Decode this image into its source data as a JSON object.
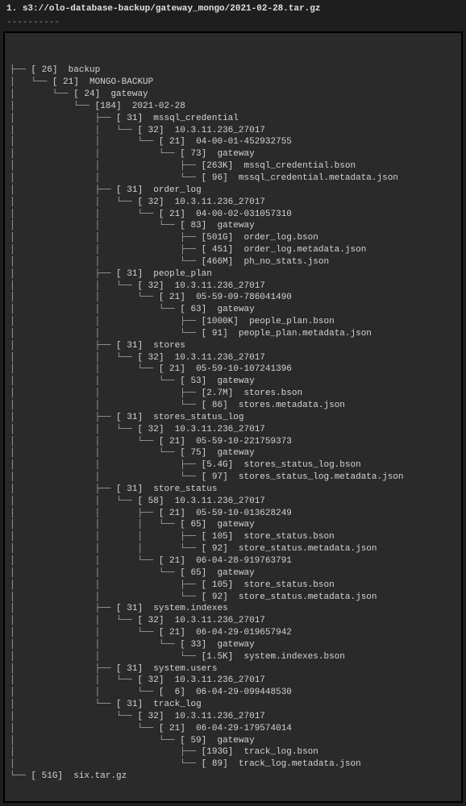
{
  "header": {
    "index": "1.",
    "path": "s3://olo-database-backup/gateway_mongo/2021-02-28.tar.gz"
  },
  "dashes": "----------",
  "tree": [
    {
      "branch": "├── ",
      "size": " 26",
      "name": "backup"
    },
    {
      "branch": "│   └── ",
      "size": " 21",
      "name": "MONGO-BACKUP"
    },
    {
      "branch": "│       └── ",
      "size": " 24",
      "name": "gateway"
    },
    {
      "branch": "│           └── ",
      "size": "184",
      "name": "2021-02-28"
    },
    {
      "branch": "│               ├── ",
      "size": " 31",
      "name": "mssql_credential"
    },
    {
      "branch": "│               │   └── ",
      "size": " 32",
      "name": "10.3.11.236_27017"
    },
    {
      "branch": "│               │       └── ",
      "size": " 21",
      "name": "04-00-01-452932755"
    },
    {
      "branch": "│               │           └── ",
      "size": " 73",
      "name": "gateway"
    },
    {
      "branch": "│               │               ├── ",
      "size": "263K",
      "name": "mssql_credential.bson"
    },
    {
      "branch": "│               │               └── ",
      "size": " 96",
      "name": "mssql_credential.metadata.json"
    },
    {
      "branch": "│               ├── ",
      "size": " 31",
      "name": "order_log"
    },
    {
      "branch": "│               │   └── ",
      "size": " 32",
      "name": "10.3.11.236_27017"
    },
    {
      "branch": "│               │       └── ",
      "size": " 21",
      "name": "04-00-02-031057310"
    },
    {
      "branch": "│               │           └── ",
      "size": " 83",
      "name": "gateway"
    },
    {
      "branch": "│               │               ├── ",
      "size": "501G",
      "name": "order_log.bson"
    },
    {
      "branch": "│               │               ├── ",
      "size": " 451",
      "name": "order_log.metadata.json"
    },
    {
      "branch": "│               │               └── ",
      "size": "466M",
      "name": "ph_no_stats.json"
    },
    {
      "branch": "│               ├── ",
      "size": " 31",
      "name": "people_plan"
    },
    {
      "branch": "│               │   └── ",
      "size": " 32",
      "name": "10.3.11.236_27017"
    },
    {
      "branch": "│               │       └── ",
      "size": " 21",
      "name": "05-59-09-786041490"
    },
    {
      "branch": "│               │           └── ",
      "size": " 63",
      "name": "gateway"
    },
    {
      "branch": "│               │               ├── ",
      "size": "1000K",
      "name": "people_plan.bson"
    },
    {
      "branch": "│               │               └── ",
      "size": " 91",
      "name": "people_plan.metadata.json"
    },
    {
      "branch": "│               ├── ",
      "size": " 31",
      "name": "stores"
    },
    {
      "branch": "│               │   └── ",
      "size": " 32",
      "name": "10.3.11.236_27017"
    },
    {
      "branch": "│               │       └── ",
      "size": " 21",
      "name": "05-59-10-107241396"
    },
    {
      "branch": "│               │           └── ",
      "size": " 53",
      "name": "gateway"
    },
    {
      "branch": "│               │               ├── ",
      "size": "2.7M",
      "name": "stores.bson"
    },
    {
      "branch": "│               │               └── ",
      "size": " 86",
      "name": "stores.metadata.json"
    },
    {
      "branch": "│               ├── ",
      "size": " 31",
      "name": "stores_status_log"
    },
    {
      "branch": "│               │   └── ",
      "size": " 32",
      "name": "10.3.11.236_27017"
    },
    {
      "branch": "│               │       └── ",
      "size": " 21",
      "name": "05-59-10-221759373"
    },
    {
      "branch": "│               │           └── ",
      "size": " 75",
      "name": "gateway"
    },
    {
      "branch": "│               │               ├── ",
      "size": "5.4G",
      "name": "stores_status_log.bson"
    },
    {
      "branch": "│               │               └── ",
      "size": " 97",
      "name": "stores_status_log.metadata.json"
    },
    {
      "branch": "│               ├── ",
      "size": " 31",
      "name": "store_status"
    },
    {
      "branch": "│               │   └── ",
      "size": " 58",
      "name": "10.3.11.236_27017"
    },
    {
      "branch": "│               │       ├── ",
      "size": " 21",
      "name": "05-59-10-013628249"
    },
    {
      "branch": "│               │       │   └── ",
      "size": " 65",
      "name": "gateway"
    },
    {
      "branch": "│               │       │       ├── ",
      "size": " 105",
      "name": "store_status.bson"
    },
    {
      "branch": "│               │       │       └── ",
      "size": " 92",
      "name": "store_status.metadata.json"
    },
    {
      "branch": "│               │       └── ",
      "size": " 21",
      "name": "06-04-28-919763791"
    },
    {
      "branch": "│               │           └── ",
      "size": " 65",
      "name": "gateway"
    },
    {
      "branch": "│               │               ├── ",
      "size": " 105",
      "name": "store_status.bson"
    },
    {
      "branch": "│               │               └── ",
      "size": " 92",
      "name": "store_status.metadata.json"
    },
    {
      "branch": "│               ├── ",
      "size": " 31",
      "name": "system.indexes"
    },
    {
      "branch": "│               │   └── ",
      "size": " 32",
      "name": "10.3.11.236_27017"
    },
    {
      "branch": "│               │       └── ",
      "size": " 21",
      "name": "06-04-29-019657942"
    },
    {
      "branch": "│               │           └── ",
      "size": " 33",
      "name": "gateway"
    },
    {
      "branch": "│               │               └── ",
      "size": "1.5K",
      "name": "system.indexes.bson"
    },
    {
      "branch": "│               ├── ",
      "size": " 31",
      "name": "system.users"
    },
    {
      "branch": "│               │   └── ",
      "size": " 32",
      "name": "10.3.11.236_27017"
    },
    {
      "branch": "│               │       └── ",
      "size": "  6",
      "name": "06-04-29-099448530"
    },
    {
      "branch": "│               └── ",
      "size": " 31",
      "name": "track_log"
    },
    {
      "branch": "│                   └── ",
      "size": " 32",
      "name": "10.3.11.236_27017"
    },
    {
      "branch": "│                       └── ",
      "size": " 21",
      "name": "06-04-29-179574014"
    },
    {
      "branch": "│                           └── ",
      "size": " 59",
      "name": "gateway"
    },
    {
      "branch": "│                               ├── ",
      "size": "193G",
      "name": "track_log.bson"
    },
    {
      "branch": "│                               └── ",
      "size": " 89",
      "name": "track_log.metadata.json"
    },
    {
      "branch": "└── ",
      "size": " 51G",
      "name": "six.tar.gz"
    }
  ]
}
